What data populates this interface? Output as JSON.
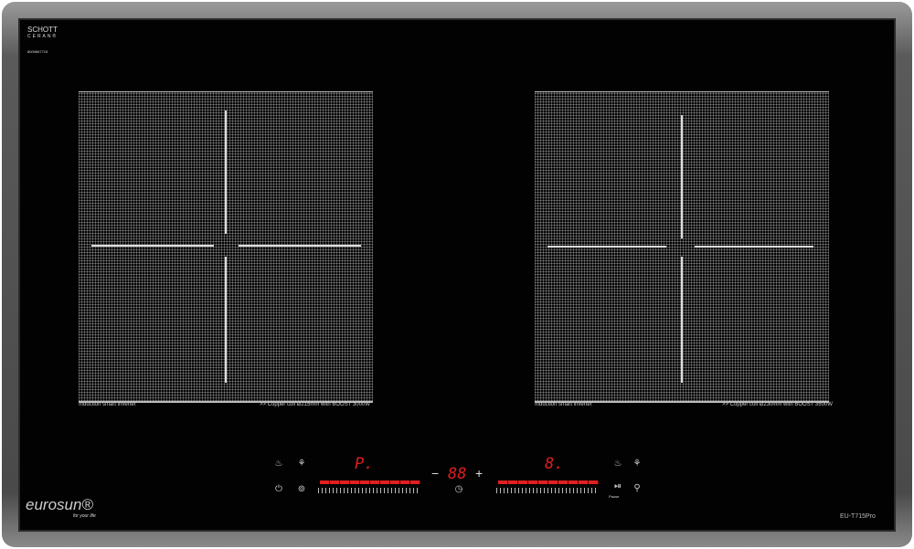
{
  "brand": {
    "glass_logo_line1": "SCHOTT",
    "glass_logo_line2": "CERAN®",
    "serial": "8009667715",
    "logo": "eurosun®",
    "tagline": "for your life",
    "model": "EU-T715Pro"
  },
  "zones": [
    {
      "caption_left": "Induction smart inverter",
      "caption_right": ">> Copper coil Ø215mm with BOOST 3000W"
    },
    {
      "caption_left": "Induction smart inverter",
      "caption_right": ">> Copper coil Ø230mm with BOOST 3500W"
    }
  ],
  "controls": {
    "left_display": "P.",
    "timer_display": "88",
    "right_display": "8.",
    "minus": "−",
    "plus": "+",
    "pause_label": "Pause",
    "slider_max": "9",
    "accent": "#e0201e"
  }
}
